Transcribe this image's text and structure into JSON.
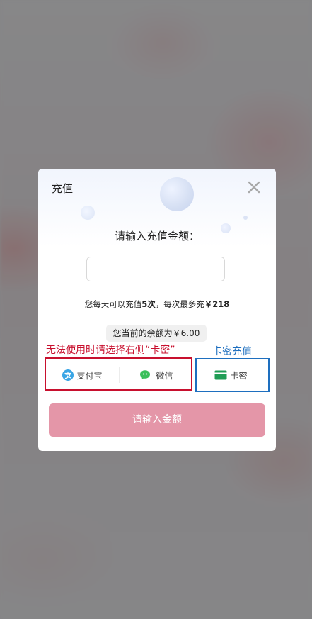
{
  "dialog": {
    "title": "充值",
    "prompt": "请输入充值金额：",
    "amount_input": {
      "value": "",
      "placeholder": ""
    },
    "limit": {
      "prefix": "您每天可以充值",
      "times": "5次",
      "middle": "，每次最多充",
      "currency": "￥",
      "max_amount": "218"
    },
    "balance": "您当前的余额为￥6.00",
    "payment_options": [
      {
        "label": "支付宝",
        "icon": "alipay-icon",
        "color": "#3aa5e5"
      },
      {
        "label": "微信",
        "icon": "wechat-icon",
        "color": "#3bbf5a"
      },
      {
        "label": "卡密",
        "icon": "card-icon",
        "color": "#1f9d55"
      }
    ],
    "submit_label": "请输入金额",
    "submit_color": "#e496a8"
  },
  "annotations": {
    "left_note": "无法使用时请选择右侧“卡密”",
    "left_color": "#c8102e",
    "right_note": "卡密充值",
    "right_color": "#1e6fbf"
  }
}
